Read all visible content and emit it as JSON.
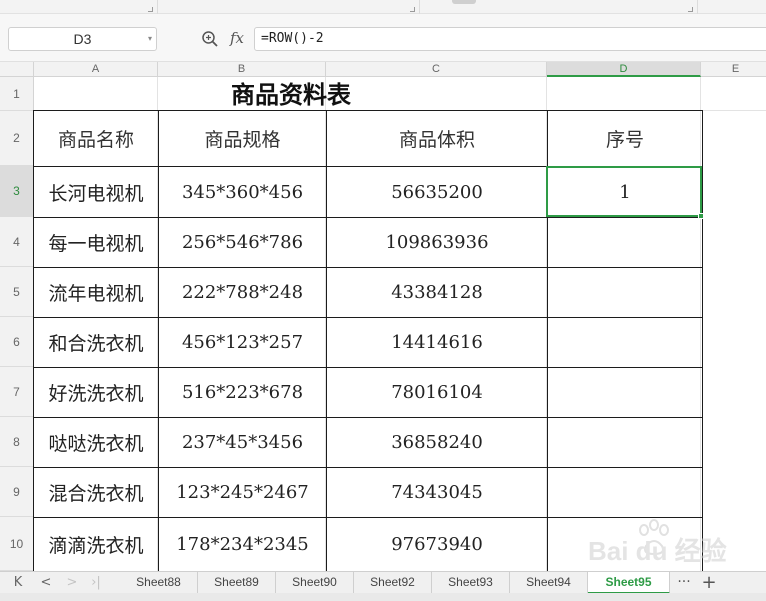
{
  "name_box": "D3",
  "formula": "=ROW()-2",
  "columns": [
    "A",
    "B",
    "C",
    "D",
    "E"
  ],
  "rows": [
    "1",
    "2",
    "3",
    "4",
    "5",
    "6",
    "7",
    "8",
    "9",
    "10"
  ],
  "active_cell": {
    "column": "D",
    "row": "3"
  },
  "sheet": {
    "title": "商品资料表",
    "headers": [
      "商品名称",
      "商品规格",
      "商品体积",
      "序号"
    ],
    "rows": [
      [
        "长河电视机",
        "345*360*456",
        "56635200",
        "1"
      ],
      [
        "每一电视机",
        "256*546*786",
        "109863936",
        ""
      ],
      [
        "流年电视机",
        "222*788*248",
        "43384128",
        ""
      ],
      [
        "和合洗衣机",
        "456*123*257",
        "14414616",
        ""
      ],
      [
        "好洗洗衣机",
        "516*223*678",
        "78016104",
        ""
      ],
      [
        "哒哒洗衣机",
        "237*45*3456",
        "36858240",
        ""
      ],
      [
        "混合洗衣机",
        "123*245*2467",
        "74343045",
        ""
      ],
      [
        "滴滴洗衣机",
        "178*234*2345",
        "97673940",
        ""
      ]
    ]
  },
  "sheet_tabs": [
    "Sheet88",
    "Sheet89",
    "Sheet90",
    "Sheet92",
    "Sheet93",
    "Sheet94",
    "Sheet95"
  ],
  "active_sheet": "Sheet95",
  "tab_nav": {
    "first": "K",
    "prev": "<",
    "next": ">",
    "last": "›|"
  },
  "tab_more": "···",
  "tab_add": "+",
  "watermark_text": "Bai du 经验",
  "colors": {
    "accent_green": "#2e9b46",
    "grid": "#e3e3e3",
    "table_border": "#1c1c1c"
  },
  "icons": [
    "zoom-icon",
    "fx-icon",
    "dropdown-icon",
    "add-sheet-icon",
    "more-tabs-icon"
  ]
}
